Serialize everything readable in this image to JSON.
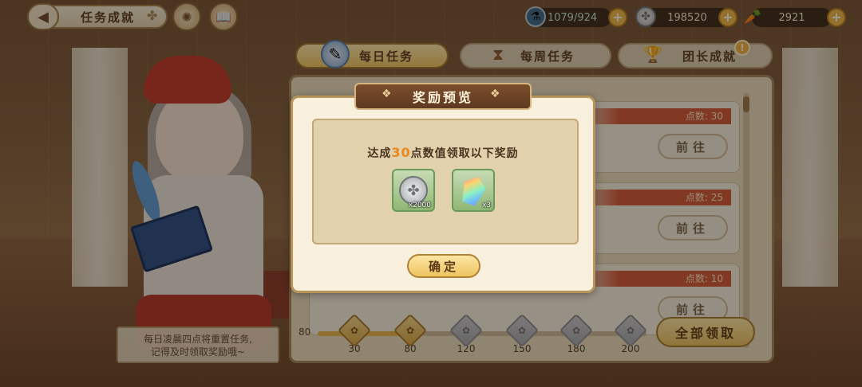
{
  "topbar": {
    "title": "任务成就",
    "back_icon": "back-arrow-icon",
    "icons": [
      "clover-icon",
      "compass-emblem-icon",
      "book-icon"
    ]
  },
  "resources": {
    "stamina": {
      "value": "1079/924",
      "icon": "stamina-potion-icon"
    },
    "coins": {
      "value": "198520",
      "icon": "silver-coin-icon"
    },
    "carrots": {
      "value": "2921",
      "icon": "carrot-icon"
    }
  },
  "tabs": [
    {
      "label": "每日任务",
      "active": true,
      "icon": "quill-book-icon"
    },
    {
      "label": "每周任务",
      "active": false,
      "icon": "hourglass-icon"
    },
    {
      "label": "团长成就",
      "active": false,
      "icon": "trophy-icon"
    }
  ],
  "alert_badge": "!",
  "tasks": [
    {
      "points": "点数: 30",
      "button": "前往"
    },
    {
      "points": "点数: 25",
      "button": "前往"
    },
    {
      "points": "点数: 10",
      "button": "前往"
    }
  ],
  "progress": {
    "start": "80",
    "current_fraction": 0.27,
    "milestones": [
      {
        "label": "30",
        "done": true
      },
      {
        "label": "80",
        "done": true
      },
      {
        "label": "120",
        "done": false
      },
      {
        "label": "150",
        "done": false
      },
      {
        "label": "180",
        "done": false
      },
      {
        "label": "200",
        "done": false
      }
    ]
  },
  "claim_all": "全部领取",
  "hint": {
    "line1": "每日凌晨四点将重置任务,",
    "line2": "记得及时领取奖励哦~"
  },
  "modal": {
    "title": "奖励预览",
    "desc_prefix": "达成",
    "desc_value": "30",
    "desc_suffix": "点数值领取以下奖励",
    "rewards": [
      {
        "icon": "silver-coin-icon",
        "qty": "x2000"
      },
      {
        "icon": "rainbow-gem-icon",
        "qty": "x3"
      }
    ],
    "confirm": "确定"
  },
  "colors": {
    "accent_gold": "#f1c865",
    "points_red": "#d35a3a",
    "highlight_orange": "#e8891f"
  }
}
